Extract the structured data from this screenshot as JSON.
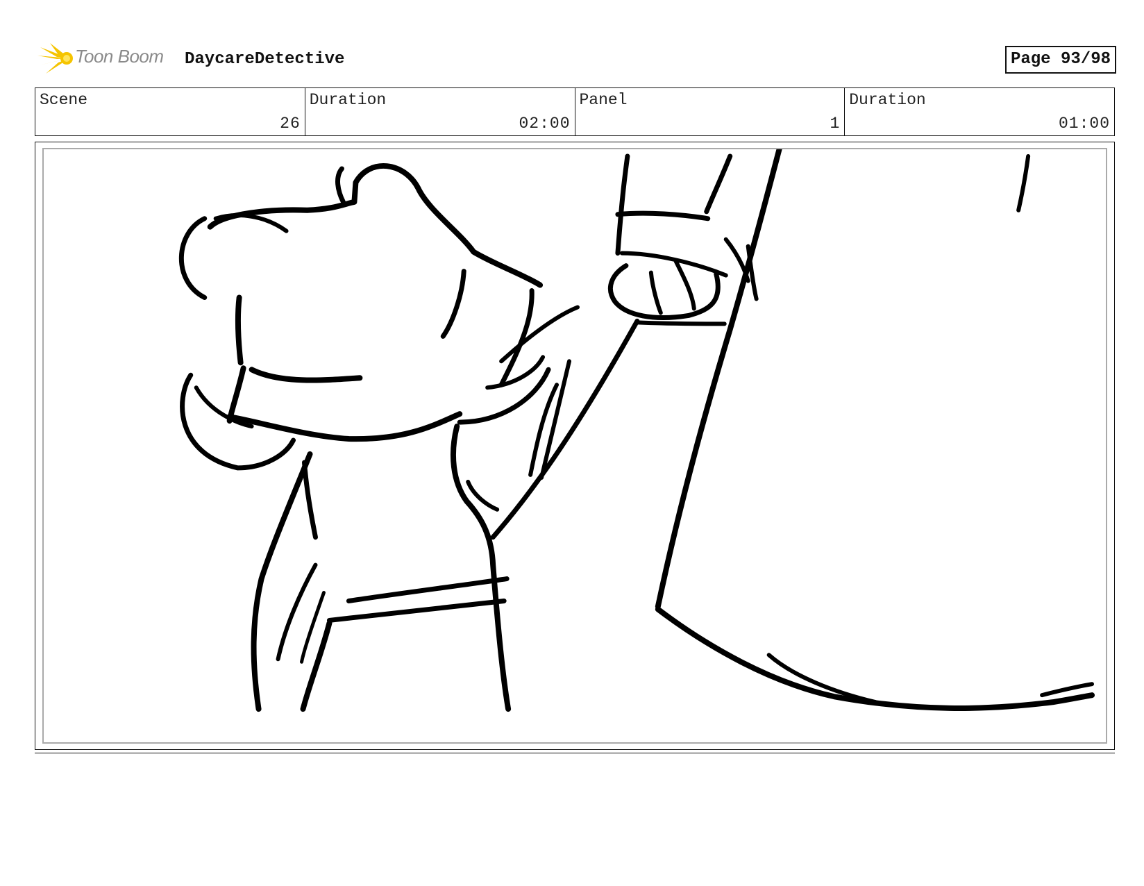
{
  "header": {
    "logo_text": "Toon Boom",
    "logo_color": "#f5c400",
    "project_title": "DaycareDetective",
    "page_label": "Page 93/98"
  },
  "info": [
    {
      "label": "Scene",
      "value": "26"
    },
    {
      "label": "Duration",
      "value": "02:00"
    },
    {
      "label": "Panel",
      "value": "1"
    },
    {
      "label": "Duration",
      "value": "01:00"
    }
  ]
}
